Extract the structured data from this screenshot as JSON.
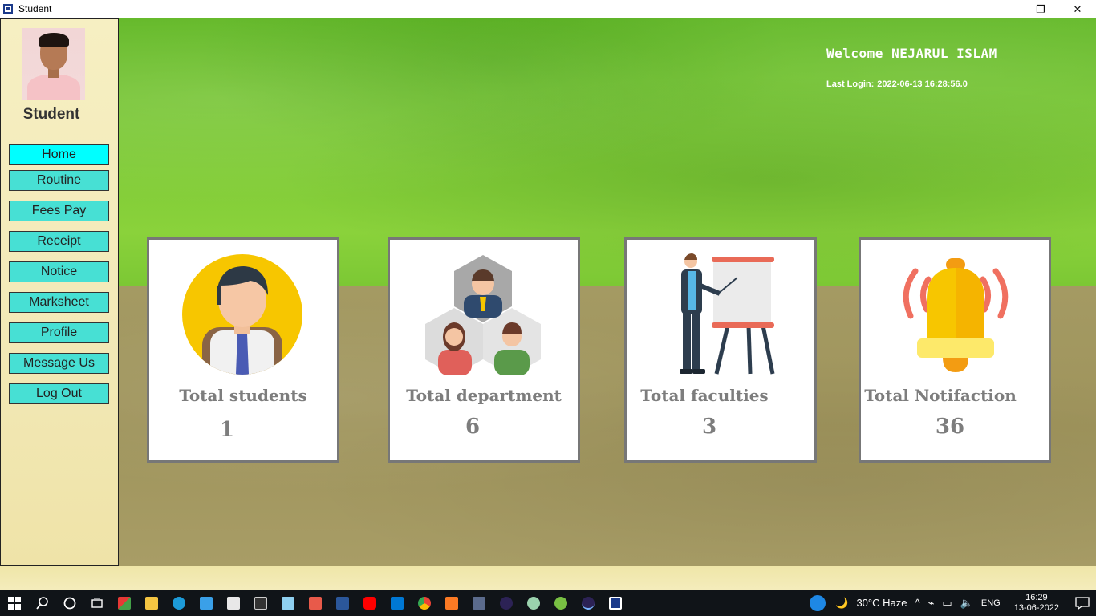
{
  "window": {
    "title": "Student",
    "minimize": "—",
    "maximize": "❐",
    "close": "✕"
  },
  "sidebar": {
    "role": "Student",
    "items": [
      {
        "label": "Home",
        "active": true
      },
      {
        "label": "Routine"
      },
      {
        "label": "Fees Pay"
      },
      {
        "label": "Receipt"
      },
      {
        "label": "Notice"
      },
      {
        "label": "Marksheet"
      },
      {
        "label": "Profile"
      },
      {
        "label": "Message Us"
      },
      {
        "label": "Log Out"
      }
    ]
  },
  "header": {
    "welcome": "Welcome NEJARUL ISLAM",
    "last_login_label": "Last Login:",
    "last_login_value": "2022-06-13 16:28:56.0"
  },
  "cards": [
    {
      "label": "Total students",
      "count": "1",
      "icon": "student-icon"
    },
    {
      "label": "Total department",
      "count": "6",
      "icon": "department-icon"
    },
    {
      "label": "Total faculties",
      "count": "3",
      "icon": "faculty-icon"
    },
    {
      "label": "Total Notifaction",
      "count": "36",
      "icon": "bell-icon"
    }
  ],
  "taskbar": {
    "weather": "30°C  Haze",
    "language": "ENG",
    "time": "16:29",
    "date": "13-06-2022"
  },
  "colors": {
    "nav_button": "#47e0d4",
    "nav_active": "#00ffff",
    "card_text": "#7d7d7d"
  }
}
